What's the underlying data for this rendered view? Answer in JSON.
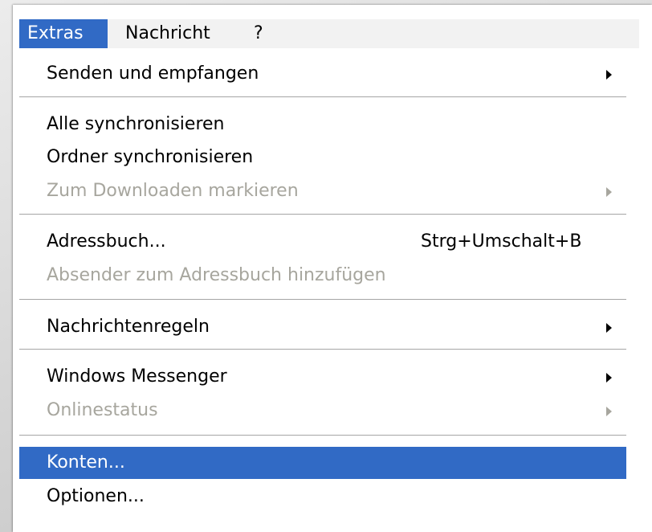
{
  "menubar": {
    "extras": "Extras",
    "nachricht": "Nachricht",
    "help": "?"
  },
  "menu": {
    "senden_empfangen": "Senden und empfangen",
    "alle_sync": "Alle synchronisieren",
    "ordner_sync": "Ordner synchronisieren",
    "zum_download": "Zum Downloaden markieren",
    "adressbuch": "Adressbuch...",
    "adressbuch_shortcut": "Strg+Umschalt+B",
    "absender_hinzufuegen": "Absender zum Adressbuch hinzufügen",
    "nachrichtenregeln": "Nachrichtenregeln",
    "windows_messenger": "Windows Messenger",
    "onlinestatus": "Onlinestatus",
    "konten": "Konten...",
    "optionen": "Optionen..."
  },
  "colors": {
    "highlight": "#316ac5",
    "disabled_text": "#a7a69e"
  },
  "icons": {
    "submenu": "submenu-arrow-icon"
  }
}
